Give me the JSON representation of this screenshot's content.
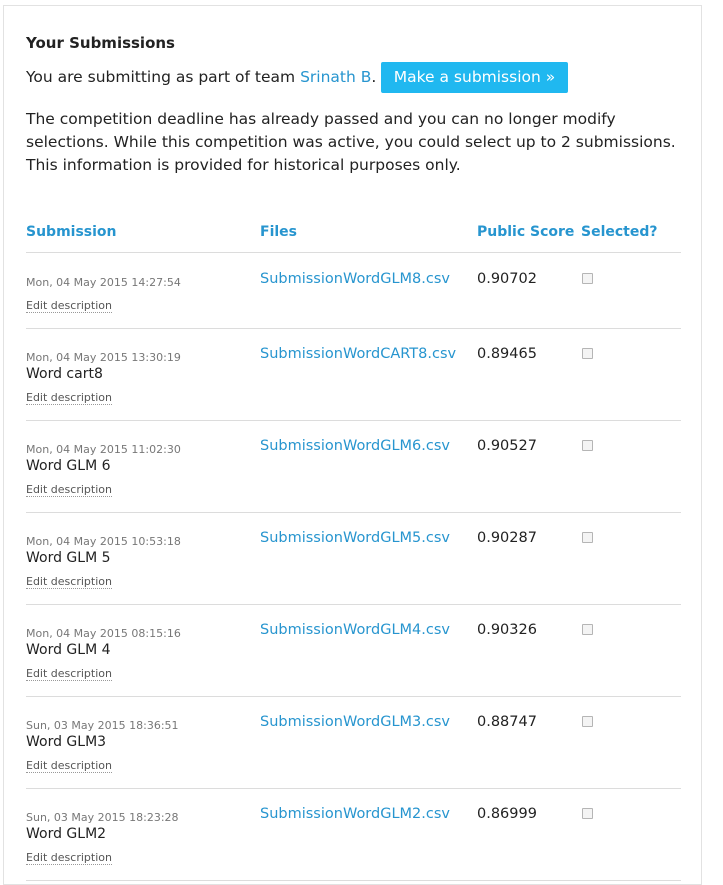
{
  "heading": "Your Submissions",
  "team": {
    "prefix": "You are submitting as part of team ",
    "name": "Srinath B",
    "suffix": "."
  },
  "make_submission_label": "Make a submission »",
  "notice": "The competition deadline has already passed and you can no longer modify selections. While this competition was active, you could select up to 2 submissions. This information is provided for historical purposes only.",
  "columns": {
    "submission": "Submission",
    "files": "Files",
    "public_score": "Public Score",
    "selected": "Selected?"
  },
  "edit_label": "Edit description",
  "rows": [
    {
      "date": "Mon, 04 May 2015 14:27:54",
      "description": "",
      "file": "SubmissionWordGLM8.csv",
      "score": "0.90702",
      "selected": false
    },
    {
      "date": "Mon, 04 May 2015 13:30:19",
      "description": "Word cart8",
      "file": "SubmissionWordCART8.csv",
      "score": "0.89465",
      "selected": false
    },
    {
      "date": "Mon, 04 May 2015 11:02:30",
      "description": "Word GLM 6",
      "file": "SubmissionWordGLM6.csv",
      "score": "0.90527",
      "selected": false
    },
    {
      "date": "Mon, 04 May 2015 10:53:18",
      "description": "Word GLM 5",
      "file": "SubmissionWordGLM5.csv",
      "score": "0.90287",
      "selected": false
    },
    {
      "date": "Mon, 04 May 2015 08:15:16",
      "description": "Word GLM 4",
      "file": "SubmissionWordGLM4.csv",
      "score": "0.90326",
      "selected": false
    },
    {
      "date": "Sun, 03 May 2015 18:36:51",
      "description": "Word GLM3",
      "file": "SubmissionWordGLM3.csv",
      "score": "0.88747",
      "selected": false
    },
    {
      "date": "Sun, 03 May 2015 18:23:28",
      "description": "Word GLM2",
      "file": "SubmissionWordGLM2.csv",
      "score": "0.86999",
      "selected": false
    }
  ]
}
